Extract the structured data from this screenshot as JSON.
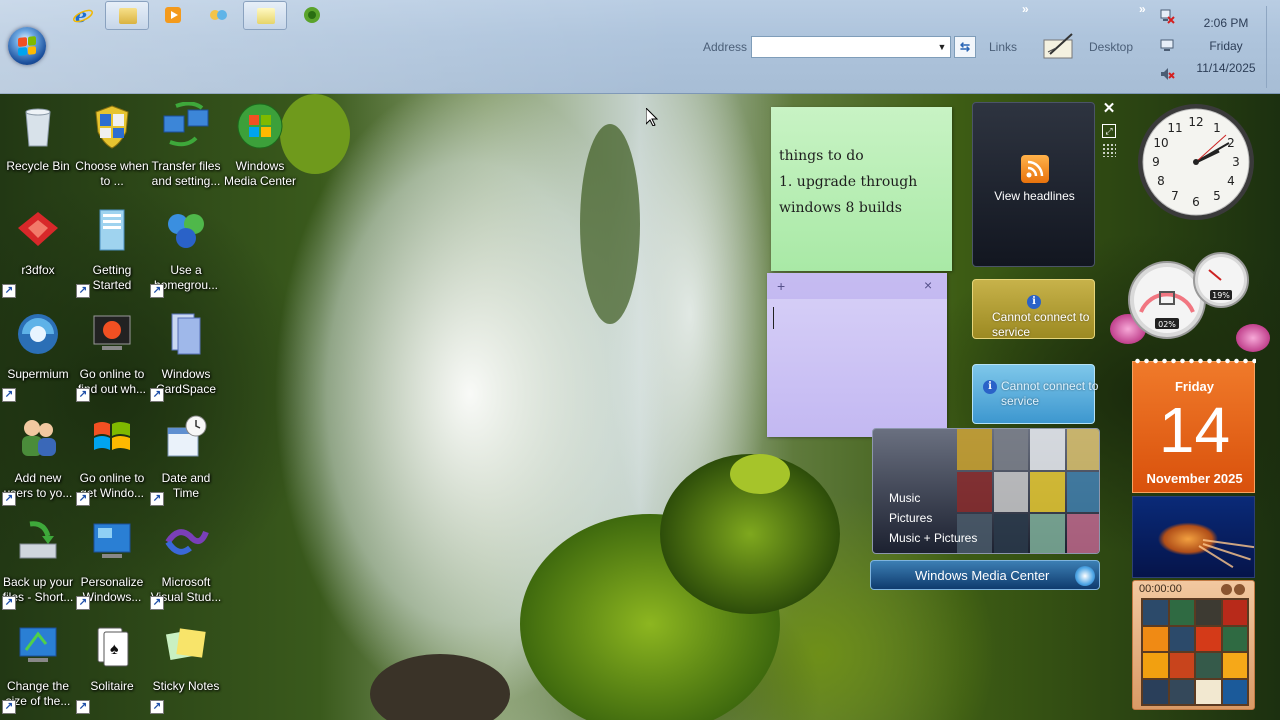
{
  "taskbar": {
    "quick_launch": [
      "internet-explorer-icon",
      "windows-explorer-icon",
      "media-player-icon",
      "messenger-icon"
    ],
    "buttons": [
      "open-window-1",
      "open-window-2"
    ],
    "extra_icon": "xbox-icon",
    "address_label": "Address",
    "address_value": "",
    "links_label": "Links",
    "desktop_label": "Desktop",
    "chevron": "»",
    "clock": {
      "time": "2:06 PM",
      "day": "Friday",
      "date": "11/14/2025"
    }
  },
  "desktop_icons": [
    {
      "label": "Recycle Bin",
      "icon": "recycle-bin-icon"
    },
    {
      "label": "Choose when to ...",
      "icon": "security-shield-icon"
    },
    {
      "label": "Transfer files and setting...",
      "icon": "transfer-files-icon"
    },
    {
      "label": "Windows Media Center",
      "icon": "media-center-icon"
    },
    {
      "label": "r3dfox",
      "icon": "r3dfox-icon"
    },
    {
      "label": "Getting Started",
      "icon": "getting-started-icon"
    },
    {
      "label": "Use a homegrou...",
      "icon": "homegroup-icon"
    },
    {
      "label": "Supermium",
      "icon": "supermium-icon"
    },
    {
      "label": "Go online to find out wh...",
      "icon": "go-online-icon"
    },
    {
      "label": "Windows CardSpace",
      "icon": "cardspace-icon"
    },
    {
      "label": "Add new users to yo...",
      "icon": "add-users-icon"
    },
    {
      "label": "Go online to get Windo...",
      "icon": "windows-logo-icon"
    },
    {
      "label": "Date and Time",
      "icon": "date-time-icon"
    },
    {
      "label": "Back up your files - Short...",
      "icon": "backup-icon"
    },
    {
      "label": "Personalize Windows...",
      "icon": "personalize-icon"
    },
    {
      "label": "Microsoft Visual Stud...",
      "icon": "visual-studio-icon"
    },
    {
      "label": "Change the size of the...",
      "icon": "display-size-icon"
    },
    {
      "label": "Solitaire",
      "icon": "solitaire-icon"
    },
    {
      "label": "Sticky Notes",
      "icon": "sticky-notes-icon"
    }
  ],
  "sticky_notes": {
    "green_text": "things to do\n1. upgrade through\nwindows 8 builds",
    "add_symbol": "+",
    "close_symbol": "×"
  },
  "gadgets": {
    "feed": {
      "label": "View headlines"
    },
    "close_symbol": "✕",
    "service_gold": {
      "message": "Cannot connect to service"
    },
    "service_blue": {
      "message": "Cannot connect to service"
    },
    "info_symbol": "i",
    "cpu": {
      "cpu_percent": "02%",
      "memory_percent": "19%"
    },
    "calendar": {
      "day_name": "Friday",
      "day_number": "14",
      "month_year": "November 2025"
    },
    "puzzle": {
      "timer": "00:00:00"
    },
    "media_center": {
      "menu": [
        "Music",
        "Pictures",
        "Music + Pictures"
      ],
      "title": "Windows Media Center"
    }
  },
  "colors": {
    "taskbar": "#aec4dc",
    "note_green": "#b8eeb4",
    "note_purple": "#cdc4f5",
    "calendar": "#e6631a"
  }
}
